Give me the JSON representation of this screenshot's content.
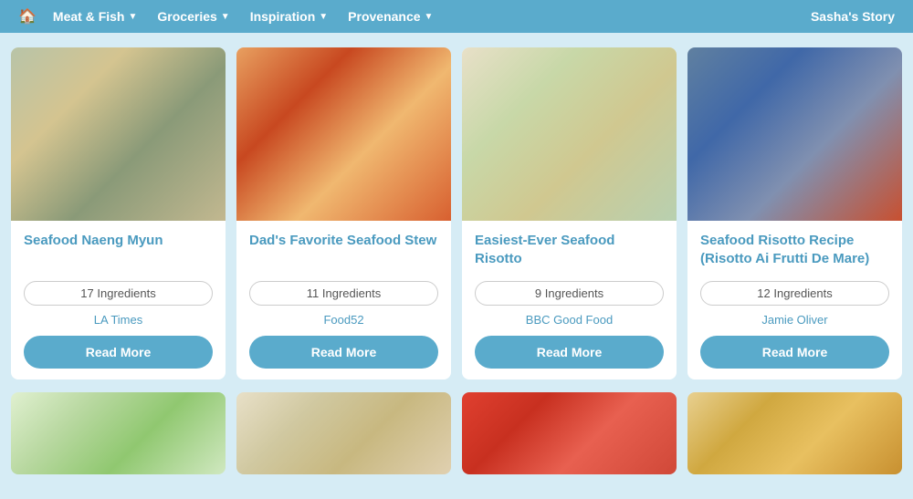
{
  "nav": {
    "home_icon": "⌂",
    "items": [
      {
        "label": "Meat & Fish",
        "has_dropdown": true
      },
      {
        "label": "Groceries",
        "has_dropdown": true
      },
      {
        "label": "Inspiration",
        "has_dropdown": true
      },
      {
        "label": "Provenance",
        "has_dropdown": true
      }
    ],
    "sashas_story": "Sasha's Story"
  },
  "cards": [
    {
      "title": "Seafood Naeng Myun",
      "ingredients": "17 Ingredients",
      "source": "LA Times",
      "read_more": "Read More",
      "img_class": "img-1"
    },
    {
      "title": "Dad's Favorite Seafood Stew",
      "ingredients": "11 Ingredients",
      "source": "Food52",
      "read_more": "Read More",
      "img_class": "img-2"
    },
    {
      "title": "Easiest-Ever Seafood Risotto",
      "ingredients": "9 Ingredients",
      "source": "BBC Good Food",
      "read_more": "Read More",
      "img_class": "img-3"
    },
    {
      "title": "Seafood Risotto Recipe (Risotto Ai Frutti De Mare)",
      "ingredients": "12 Ingredients",
      "source": "Jamie Oliver",
      "read_more": "Read More",
      "img_class": "img-4"
    }
  ],
  "bottom_cards": [
    {
      "img_class": "img-b1"
    },
    {
      "img_class": "img-b2"
    },
    {
      "img_class": "img-b3"
    },
    {
      "img_class": "img-b4"
    }
  ]
}
